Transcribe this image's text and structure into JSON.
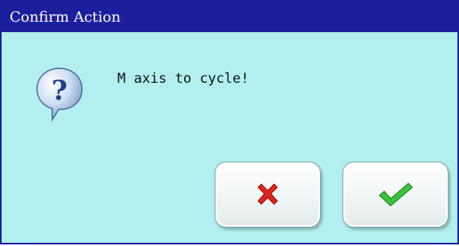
{
  "dialog": {
    "title": "Confirm Action",
    "message": "M axis to cycle!",
    "icon": "question-icon"
  },
  "buttons": {
    "cancel": {
      "icon": "cross-icon"
    },
    "confirm": {
      "icon": "checkmark-icon"
    }
  },
  "colors": {
    "titlebar": "#1c1f9c",
    "body": "#b2f0ef",
    "cancel_icon": "#e0241c",
    "confirm_icon": "#39c43c"
  }
}
